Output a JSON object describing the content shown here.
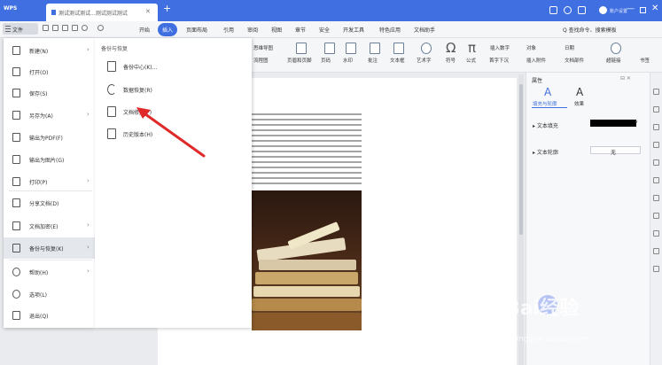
{
  "titlebar": {
    "app": "WPS",
    "doc_tab": "测试测试测试...测试测试测试",
    "new_tab": "+",
    "user": "账户设置",
    "win_min": "—",
    "win_close": "✕"
  },
  "menubar": {
    "file": "文件",
    "tabs": [
      "开始",
      "插入",
      "页面布局",
      "引用",
      "审阅",
      "视图",
      "章节",
      "安全",
      "开发工具",
      "特色应用",
      "文档助手"
    ],
    "active_tab": "插入",
    "search": "Q 查找命令、搜索模板"
  },
  "ribbon": {
    "items": [
      "页眉和页脚",
      "页码",
      "水印",
      "批注",
      "文本框",
      "艺术字",
      "符号",
      "公式",
      "插入数字",
      "对象",
      "日期",
      "超链接",
      "书签",
      "文档部件",
      "插入附件",
      "首字下沉"
    ],
    "partial_labels": [
      "思维导图",
      "流程图"
    ]
  },
  "file_menu": {
    "items": [
      {
        "label": "新建(N)",
        "icon": "new-doc-icon",
        "arrow": true
      },
      {
        "label": "打开(O)",
        "icon": "folder-icon",
        "arrow": false
      },
      {
        "label": "保存(S)",
        "icon": "save-icon",
        "arrow": false
      },
      {
        "label": "另存为(A)",
        "icon": "save-as-icon",
        "arrow": true
      },
      {
        "label": "输出为PDF(F)",
        "icon": "pdf-icon",
        "arrow": false
      },
      {
        "label": "输出为图片(G)",
        "icon": "image-icon",
        "arrow": false
      },
      {
        "label": "打印(P)",
        "icon": "printer-icon",
        "arrow": true
      },
      {
        "label": "分享文档(D)",
        "icon": "share-icon",
        "arrow": false
      },
      {
        "label": "文档加密(E)",
        "icon": "lock-icon",
        "arrow": true
      },
      {
        "label": "备份与恢复(K)",
        "icon": "backup-icon",
        "arrow": true
      },
      {
        "label": "帮助(H)",
        "icon": "help-icon",
        "arrow": true
      },
      {
        "label": "选项(L)",
        "icon": "gear-icon",
        "arrow": false
      },
      {
        "label": "退出(Q)",
        "icon": "exit-icon",
        "arrow": false
      }
    ],
    "highlighted": "备份与恢复(K)"
  },
  "submenu": {
    "header": "备份与恢复",
    "items": [
      {
        "label": "备份中心(K)...",
        "icon": "backup-center-icon"
      },
      {
        "label": "数据恢复(R)",
        "icon": "data-recovery-icon"
      },
      {
        "label": "文档修复(F)",
        "icon": "doc-repair-icon"
      },
      {
        "label": "历史版本(H)",
        "icon": "history-version-icon"
      }
    ]
  },
  "right_panel": {
    "title": "属性",
    "tabs": [
      "填充与轮廓",
      "效果"
    ],
    "fill_label": "文本填充",
    "outline_label": "文本轮廓",
    "outline_value": "无",
    "fill_color": "#000000"
  },
  "watermark": {
    "brand": "Bai经验",
    "url": "jingyan.baidu.com"
  },
  "colors": {
    "title_blue": "#3f6fe0",
    "arrow_red": "#e02a2a"
  }
}
